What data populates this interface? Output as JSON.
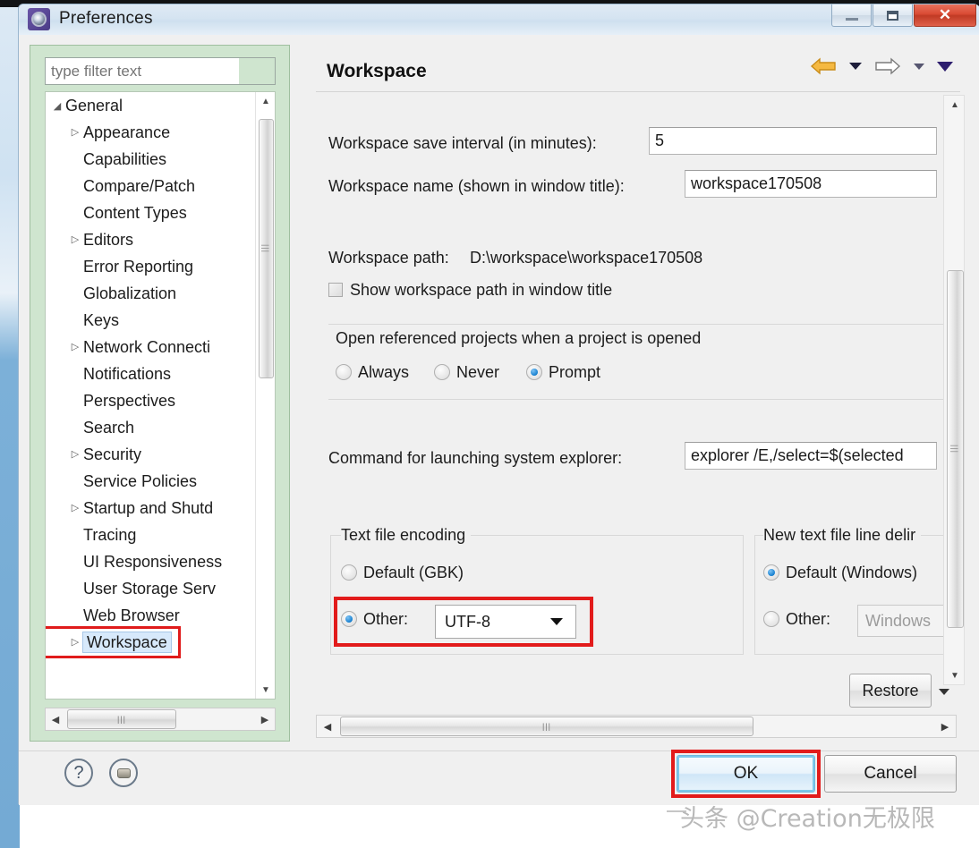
{
  "window": {
    "title": "Preferences",
    "icon": "preferences-gear-icon",
    "controls": {
      "minimize": "–",
      "maximize": "❐",
      "close": "✕"
    }
  },
  "sidebar": {
    "filter": {
      "value": "",
      "placeholder": "type filter text"
    },
    "tree": [
      {
        "label": "General",
        "level": 0,
        "twisty": "expanded",
        "selected": false
      },
      {
        "label": "Appearance",
        "level": 1,
        "twisty": "collapsed",
        "selected": false
      },
      {
        "label": "Capabilities",
        "level": 1,
        "twisty": "none",
        "selected": false
      },
      {
        "label": "Compare/Patch",
        "level": 1,
        "twisty": "none",
        "selected": false
      },
      {
        "label": "Content Types",
        "level": 1,
        "twisty": "none",
        "selected": false
      },
      {
        "label": "Editors",
        "level": 1,
        "twisty": "collapsed",
        "selected": false
      },
      {
        "label": "Error Reporting",
        "level": 1,
        "twisty": "none",
        "selected": false
      },
      {
        "label": "Globalization",
        "level": 1,
        "twisty": "none",
        "selected": false
      },
      {
        "label": "Keys",
        "level": 1,
        "twisty": "none",
        "selected": false
      },
      {
        "label": "Network Connecti",
        "level": 1,
        "twisty": "collapsed",
        "selected": false
      },
      {
        "label": "Notifications",
        "level": 1,
        "twisty": "none",
        "selected": false
      },
      {
        "label": "Perspectives",
        "level": 1,
        "twisty": "none",
        "selected": false
      },
      {
        "label": "Search",
        "level": 1,
        "twisty": "none",
        "selected": false
      },
      {
        "label": "Security",
        "level": 1,
        "twisty": "collapsed",
        "selected": false
      },
      {
        "label": "Service Policies",
        "level": 1,
        "twisty": "none",
        "selected": false
      },
      {
        "label": "Startup and Shutd",
        "level": 1,
        "twisty": "collapsed",
        "selected": false
      },
      {
        "label": "Tracing",
        "level": 1,
        "twisty": "none",
        "selected": false
      },
      {
        "label": "UI Responsiveness",
        "level": 1,
        "twisty": "none",
        "selected": false
      },
      {
        "label": "User Storage Serv",
        "level": 1,
        "twisty": "none",
        "selected": false
      },
      {
        "label": "Web Browser",
        "level": 1,
        "twisty": "none",
        "selected": false
      },
      {
        "label": "Workspace",
        "level": 1,
        "twisty": "collapsed",
        "selected": true
      }
    ]
  },
  "page": {
    "title": "Workspace",
    "nav": {
      "back": "back-arrow-icon",
      "back_menu": "chevron-down-icon",
      "forward": "forward-arrow-icon",
      "forward_menu": "chevron-down-icon",
      "view_menu": "chevron-down-icon"
    },
    "fields": {
      "save_interval_label": "Workspace save interval (in minutes):",
      "save_interval_value": "5",
      "workspace_name_label": "Workspace name (shown in window title):",
      "workspace_name_value": "workspace170508",
      "workspace_path_label": "Workspace path:",
      "workspace_path_value": "D:\\workspace\\workspace170508",
      "show_path_checkbox_label": "Show workspace path in window title",
      "show_path_checked": false
    },
    "open_referenced": {
      "label": "Open referenced projects when a project is opened",
      "options": [
        {
          "label": "Always",
          "selected": false
        },
        {
          "label": "Never",
          "selected": false
        },
        {
          "label": "Prompt",
          "selected": true
        }
      ]
    },
    "explorer": {
      "label": "Command for launching system explorer:",
      "value": "explorer /E,/select=$(selected"
    },
    "text_file_encoding": {
      "group_label": "Text file encoding",
      "default_label": "Default (GBK)",
      "default_selected": false,
      "other_label": "Other:",
      "other_selected": true,
      "combo_value": "UTF-8",
      "combo_arrow": "chevron-down-icon",
      "highlight_color": "#e21b1b"
    },
    "line_delimiter": {
      "group_label": "New text file line delir",
      "default_label": "Default (Windows)",
      "default_selected": true,
      "other_label": "Other:",
      "other_selected": false,
      "other_value": "Windows"
    },
    "restore_button": "Restore",
    "restore_caret": "chevron-down-icon"
  },
  "scrollbars": {
    "up_arrow": "▲",
    "down_arrow": "▼",
    "left_arrow": "◀",
    "right_arrow": "▶",
    "grip": "|||"
  },
  "footer": {
    "help_icon": "question-mark-icon",
    "menu_icon": "shell-menu-icon",
    "ok_label": "OK",
    "cancel_label": "Cancel",
    "ok_highlight_color": "#e21b1b"
  },
  "watermark": "头条 @Creation无极限"
}
